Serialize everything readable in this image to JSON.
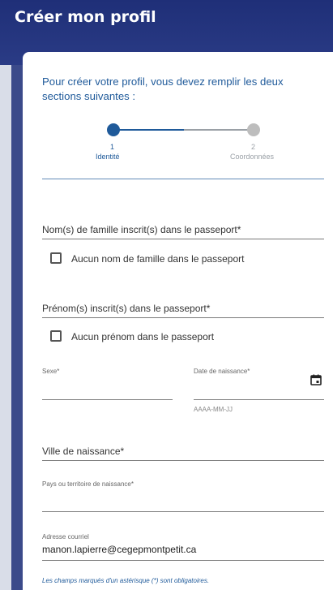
{
  "header": {
    "title": "Créer mon profil"
  },
  "intro": {
    "text": "Pour créer votre profil, vous devez remplir les deux sections suivantes :"
  },
  "stepper": {
    "steps": [
      {
        "number": "1",
        "label": "Identité",
        "active": true
      },
      {
        "number": "2",
        "label": "Coordonnées",
        "active": false
      }
    ]
  },
  "form": {
    "lastname_label": "Nom(s) de famille inscrit(s) dans le passeport*",
    "no_lastname_label": "Aucun nom de famille dans le passeport",
    "firstname_label": "Prénom(s) inscrit(s) dans le passeport*",
    "no_firstname_label": "Aucun prénom dans le passeport",
    "sex_label": "Sexe*",
    "birthdate_label": "Date de naissance*",
    "birthdate_hint": "AAAA-MM-JJ",
    "birthcity_label": "Ville de naissance*",
    "birthcountry_label": "Pays ou territoire de naissance*",
    "email_label": "Adresse courriel",
    "email_value": "manon.lapierre@cegepmontpetit.ca",
    "required_note": "Les champs marqués d'un astérisque (*) sont obligatoires."
  },
  "colors": {
    "primary": "#1f5a9a",
    "header_bg": "#1f2f78"
  },
  "icons": {
    "date": "calendar-icon"
  }
}
